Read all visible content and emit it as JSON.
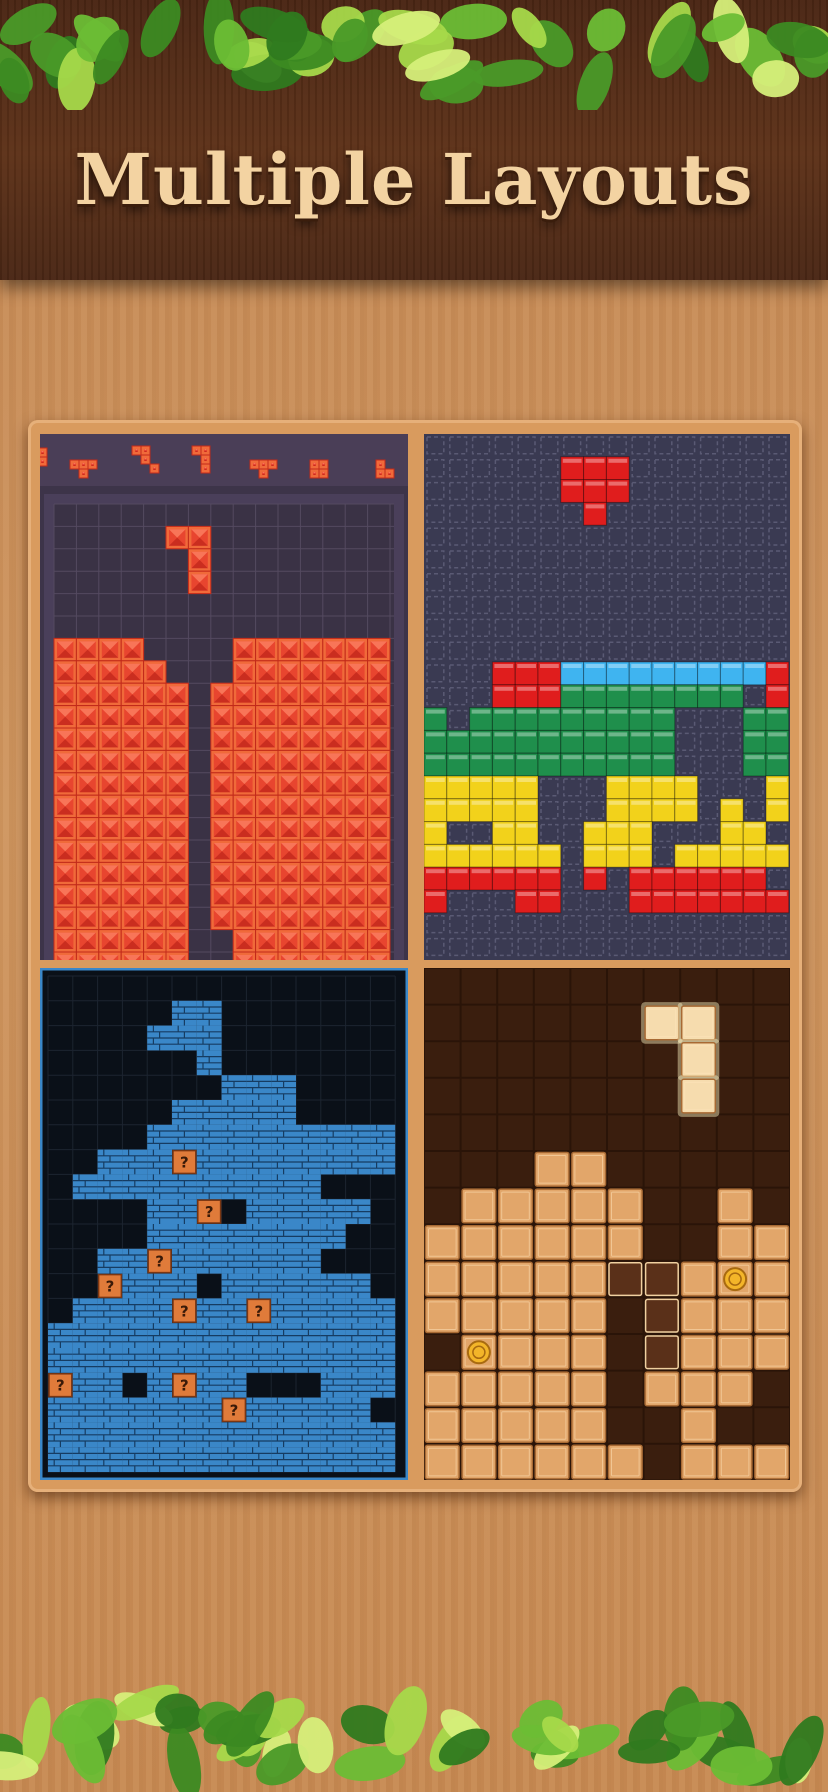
{
  "header": {
    "title": "Multiple Layouts"
  },
  "layouts": [
    {
      "name": "jewel-red"
    },
    {
      "name": "classic-tetris"
    },
    {
      "name": "blue-brick"
    },
    {
      "name": "wood-block"
    }
  ],
  "colors": {
    "banner": "#5e3219",
    "title": "#f3d3a2",
    "frame": "#d99b5e",
    "jewel_red": "#e8452f",
    "tetris_blue": "#3fb4f0",
    "tetris_green": "#1f8f4c",
    "tetris_yellow": "#f2d21b",
    "tetris_red": "#e01d1d",
    "brick_blue": "#3a87c8",
    "question_block": "#e07b3a",
    "wood_block": "#e2a66a"
  }
}
